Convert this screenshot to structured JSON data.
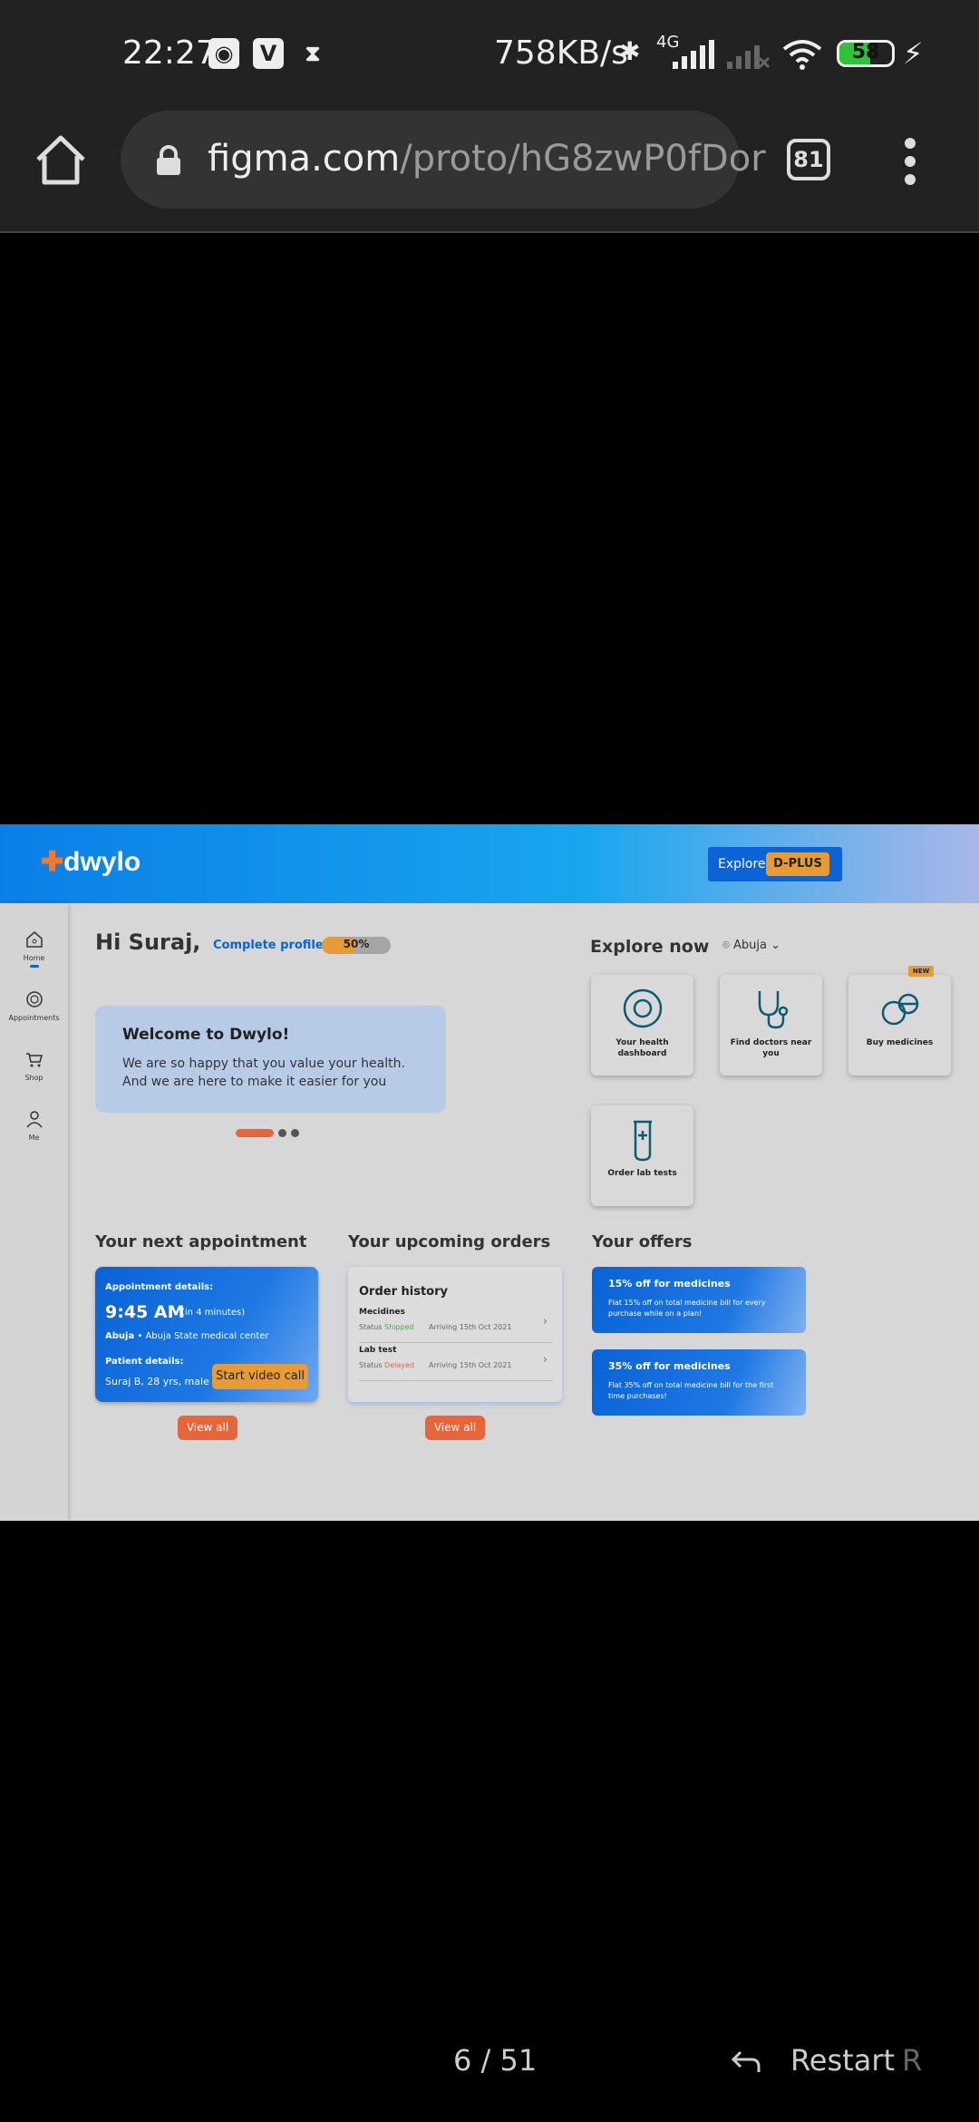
{
  "status_bar": {
    "time": "22:27",
    "speed": "758KB/s",
    "network": "4G",
    "battery": "58",
    "battery_level": 0.58
  },
  "browser": {
    "url_host": "figma.com",
    "url_path": "/proto/hG8zwP0fDor",
    "tab_count": "81"
  },
  "app": {
    "brand": "dwylo",
    "explore_label": "Explore",
    "dplus_label": "D-PLUS",
    "sidebar": [
      {
        "label": "Home",
        "icon": "home-icon"
      },
      {
        "label": "Appointments",
        "icon": "appointments-icon"
      },
      {
        "label": "Shop",
        "icon": "cart-icon"
      },
      {
        "label": "Me",
        "icon": "user-icon"
      }
    ],
    "greeting": "Hi Suraj,",
    "complete_profile": "Complete profile",
    "profile_percent": "50%",
    "profile_progress": 0.5,
    "welcome_title": "Welcome to Dwylo!",
    "welcome_text": "We are so happy that you value your health. And we are here to make it easier for you",
    "explore_title": "Explore now",
    "location": "Abuja",
    "tiles": [
      {
        "label": "Your health dashboard",
        "icon": "dashboard-icon"
      },
      {
        "label": "Find doctors near you",
        "icon": "stethoscope-icon"
      },
      {
        "label": "Buy medicines",
        "icon": "pills-icon"
      },
      {
        "label": "Order lab tests",
        "icon": "test-tube-icon"
      }
    ],
    "new_badge": "NEW",
    "appointment": {
      "section_title": "Your next appointment",
      "details_label": "Appointment details:",
      "time": "9:45 AM",
      "relative": "(in 4 minutes)",
      "city": "Abuja",
      "place": "Abuja State medical center",
      "patient_label": "Patient details:",
      "patient": "Suraj B, 28 yrs, male",
      "video_call": "Start video call",
      "view_all": "View all"
    },
    "orders": {
      "section_title": "Your upcoming orders",
      "header": "Order history",
      "status_label": "Status",
      "rows": [
        {
          "name": "Mecidines",
          "status": "Shipped",
          "status_color": "#3db24a",
          "arriving": "Arriving 15th Oct 2021"
        },
        {
          "name": "Lab test",
          "status": "Delayed",
          "status_color": "#e8643a",
          "arriving": "Arriving 15th Oct 2021"
        }
      ],
      "view_all": "View all"
    },
    "offers": {
      "section_title": "Your offers",
      "items": [
        {
          "title": "15% off for medicines",
          "desc": "Flat 15% off on total medicine bill for every purchase while on a plan!"
        },
        {
          "title": "35% off for medicines",
          "desc": "Flat 35% off on total medicine bill for the first time purchases!"
        }
      ]
    }
  },
  "bottom": {
    "pager": "6 / 51",
    "restart": "Restart",
    "restart_key": "R"
  }
}
